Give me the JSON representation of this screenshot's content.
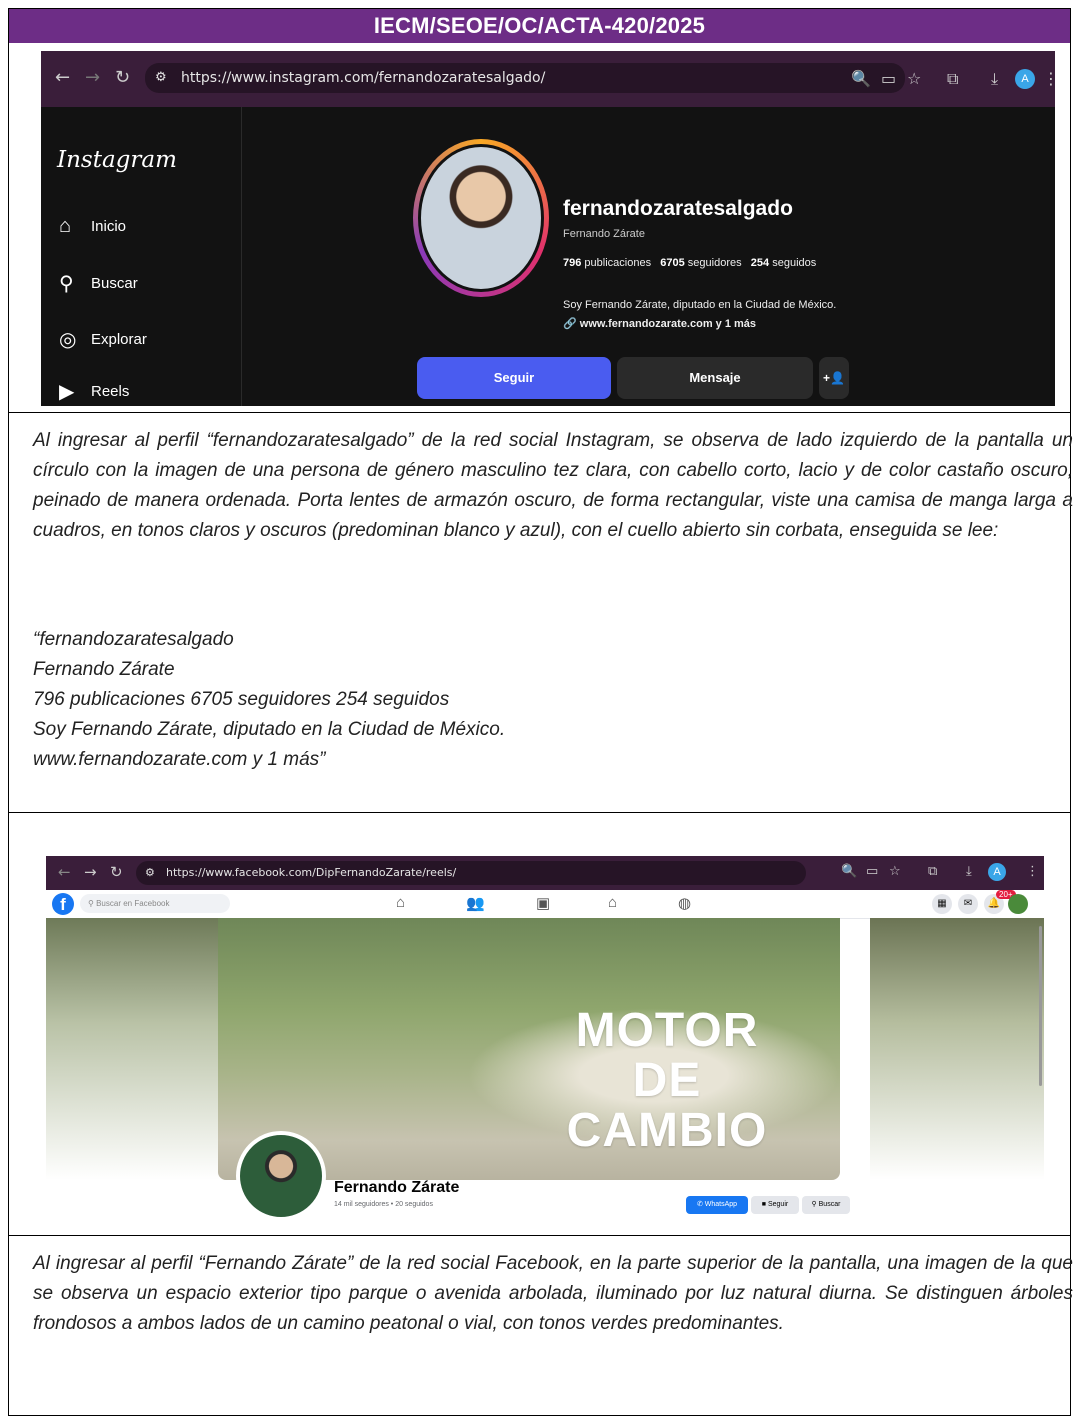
{
  "header": "IECM/SEOE/OC/ACTA-420/2025",
  "instagram": {
    "url": "https://www.instagram.com/fernandozaratesalgado/",
    "logo": "Instagram",
    "nav": [
      {
        "label": "Inicio",
        "icon": "home-icon",
        "glyph": "⌂"
      },
      {
        "label": "Buscar",
        "icon": "search-icon",
        "glyph": "🔍"
      },
      {
        "label": "Explorar",
        "icon": "compass-icon",
        "glyph": "◎"
      },
      {
        "label": "Reels",
        "icon": "reels-icon",
        "glyph": "▶"
      }
    ],
    "username": "fernandozaratesalgado",
    "full_name": "Fernando Zárate",
    "posts": "796",
    "posts_label": "publicaciones",
    "followers": "6705",
    "followers_label": "seguidores",
    "following": "254",
    "following_label": "seguidos",
    "bio": "Soy Fernando Zárate, diputado en la Ciudad de México.",
    "link": "www.fernandozarate.com y 1 más",
    "follow_button": "Seguir",
    "message_button": "Mensaje",
    "avatar_letter": "A"
  },
  "description_1": "Al ingresar al perfil “fernandozaratesalgado” de la red social Instagram, se observa de lado izquierdo de la pantalla un círculo con la imagen de una persona de género masculino tez clara, con cabello corto, lacio y de color castaño oscuro, peinado de manera ordenada. Porta lentes de armazón oscuro, de forma rectangular, viste una camisa de manga larga a cuadros, en tonos claros y oscuros (predominan blanco y azul), con el cuello abierto sin corbata, enseguida se lee:",
  "quote_1": [
    "“fernandozaratesalgado",
    "Fernando Zárate",
    "796 publicaciones 6705 seguidores 254 seguidos",
    "Soy Fernando Zárate, diputado en la Ciudad de México.",
    "www.fernandozarate.com y 1 más”"
  ],
  "facebook": {
    "url": "https://www.facebook.com/DipFernandoZarate/reels/",
    "search_placeholder": "Buscar en Facebook",
    "badge": "20+",
    "cover_lines": [
      "MOTOR",
      "DE",
      "CAMBIO"
    ],
    "name": "Fernando Zárate",
    "stats": "14 mil seguidores • 20 seguidos",
    "whatsapp_button": "WhatsApp",
    "follow_button": "Seguir",
    "search_button": "Buscar",
    "avatar_letter": "A"
  },
  "description_2": "Al ingresar al perfil “Fernando Zárate” de la red social Facebook, en la parte superior de la pantalla, una imagen de la que se observa un espacio exterior tipo parque o avenida arbolada, iluminado por luz natural diurna. Se distinguen árboles frondosos a ambos lados de un camino peatonal o vial, con tonos verdes predominantes."
}
